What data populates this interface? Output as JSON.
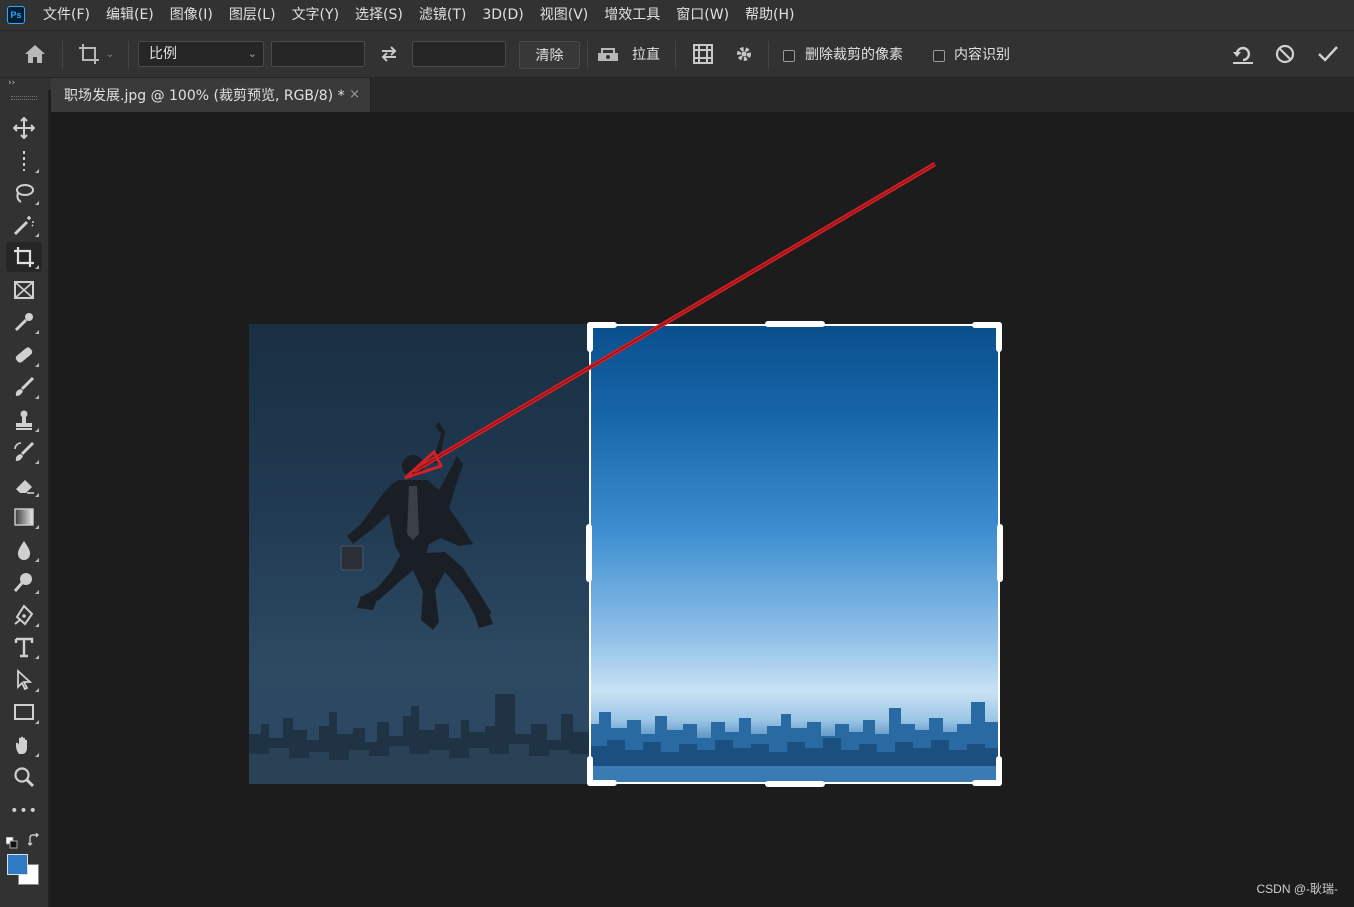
{
  "app": {
    "logo": "Ps"
  },
  "menu": [
    "文件(F)",
    "编辑(E)",
    "图像(I)",
    "图层(L)",
    "文字(Y)",
    "选择(S)",
    "滤镜(T)",
    "3D(D)",
    "视图(V)",
    "增效工具",
    "窗口(W)",
    "帮助(H)"
  ],
  "options": {
    "ratio": "比例",
    "width_value": "",
    "height_value": "",
    "clear_label": "清除",
    "straighten_label": "拉直",
    "delete_cropped_label": "删除裁剪的像素",
    "delete_cropped_checked": false,
    "content_aware_label": "内容识别",
    "content_aware_checked": false
  },
  "document": {
    "tab_title": "职场发展.jpg @ 100% (裁剪预览, RGB/8) *",
    "close_glyph": "×"
  },
  "toolbar": {
    "collapse_glyph": "››",
    "more_glyph": "•••",
    "active_tool": "crop",
    "foreground_color": "#2f7ac4",
    "background_color": "#ffffff"
  },
  "colors": {
    "annotation_arrow": "#d42027",
    "crop_frame": "#ffffff"
  },
  "watermark": "CSDN @-耿瑞-"
}
